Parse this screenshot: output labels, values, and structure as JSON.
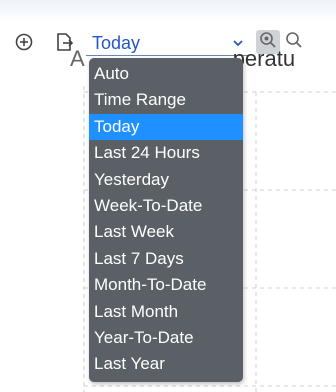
{
  "toolbar": {
    "add_icon": "plus-circle-icon",
    "export_icon": "export-document-icon",
    "zoom_in_icon": "zoom-in-icon",
    "zoom_icon": "magnifier-icon"
  },
  "range_select": {
    "value": "Today",
    "chevron_icon": "chevron-down-icon"
  },
  "chart": {
    "title_left": "A",
    "title_right": "peratu"
  },
  "dropdown": {
    "options": [
      "Auto",
      "Time Range",
      "Today",
      "Last 24 Hours",
      "Yesterday",
      "Week-To-Date",
      "Last Week",
      "Last 7 Days",
      "Month-To-Date",
      "Last Month",
      "Year-To-Date",
      "Last Year"
    ],
    "selected": "Today"
  },
  "colors": {
    "menu_bg": "#5b5f66",
    "menu_selected": "#1e90ff",
    "select_text": "#2456c9"
  }
}
